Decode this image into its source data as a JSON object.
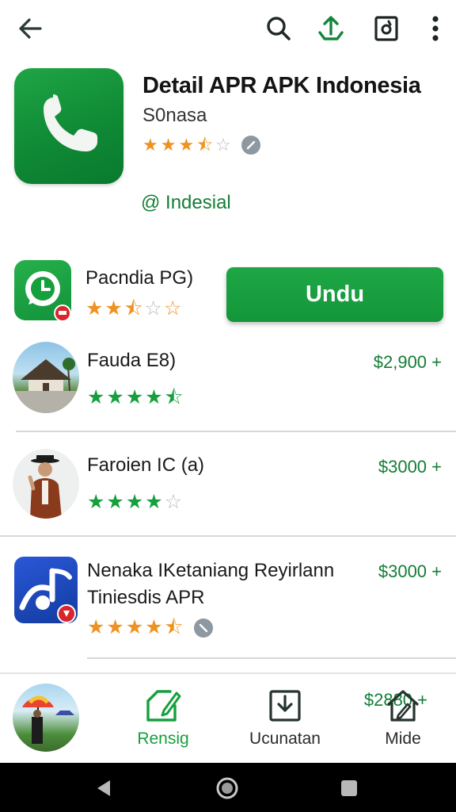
{
  "toolbar": {
    "back_icon": "arrow-left-icon",
    "search_icon": "search-icon",
    "share_icon": "share-upload-icon",
    "settings_icon": "settings-square-icon",
    "more_icon": "more-vertical-icon"
  },
  "app": {
    "title": "Detail APR APK Indonesia",
    "developer": "S0nasa",
    "rating_stars": 3.5,
    "tag": "@ Indesial",
    "icon": "phone-icon",
    "accent_color": "#16a03d"
  },
  "install_button": {
    "label": "Undu"
  },
  "list": [
    {
      "name": "Pacndia PG)",
      "stars": 2.5,
      "star_color": "orange",
      "price": ""
    },
    {
      "name": "Fauda E8)",
      "stars": 4.5,
      "star_color": "green",
      "price": "$2,900 +"
    },
    {
      "name": "Faroien IC (a)",
      "stars": 4.5,
      "star_color": "green",
      "price": "$3000 +"
    },
    {
      "name_line1": "Nenaka IKetaniang Reyirlann",
      "name_line2": "Tiniesdis APR",
      "stars": 4.5,
      "star_color": "orange",
      "price": "$3000 +"
    }
  ],
  "partial_price": "$2880 +",
  "bottom_nav": [
    {
      "label": "Rensig",
      "icon": "tag-edit-icon",
      "active": true
    },
    {
      "label": "Ucunatan",
      "icon": "download-icon",
      "active": false
    },
    {
      "label": "Mide",
      "icon": "home-edit-icon",
      "active": false
    }
  ],
  "system_nav": {
    "back": "back-triangle-icon",
    "home": "home-circle-icon",
    "recents": "recents-square-icon"
  }
}
